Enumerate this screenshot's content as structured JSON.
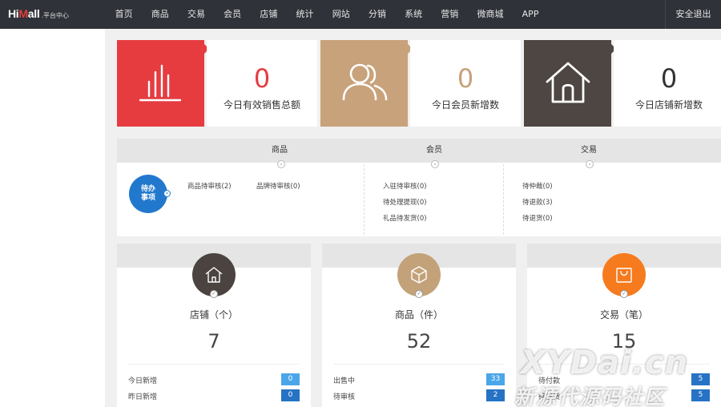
{
  "header": {
    "logo_mark_a": "Hi",
    "logo_mark_b": "M",
    "logo_mark_c": "all",
    "logo_sub": ".平台中心",
    "nav": [
      "首页",
      "商品",
      "交易",
      "会员",
      "店铺",
      "统计",
      "网站",
      "分销",
      "系统",
      "营销",
      "微商城",
      "APP"
    ],
    "logout": "安全退出"
  },
  "stats": [
    {
      "value": "0",
      "label": "今日有效销售总额",
      "color": "#e63c40",
      "value_color": "#e63c40",
      "icon": "bar-chart-icon"
    },
    {
      "value": "0",
      "label": "今日会员新增数",
      "color": "#c7a27a",
      "value_color": "#c7a27a",
      "icon": "users-icon"
    },
    {
      "value": "0",
      "label": "今日店铺新增数",
      "color": "#4d4642",
      "value_color": "#333333",
      "icon": "home-icon"
    }
  ],
  "todo": {
    "badge_line1": "待办",
    "badge_line2": "事项",
    "columns": [
      {
        "title": "商品",
        "links": [
          "商品待审核(2)",
          "品牌待审核(0)"
        ]
      },
      {
        "title": "会员",
        "links": [
          "入驻待审核(0)",
          "待处理提现(0)",
          "礼品待发货(0)"
        ]
      },
      {
        "title": "交易",
        "links": [
          "待仲裁(0)",
          "待退款(3)",
          "待退货(0)"
        ]
      }
    ]
  },
  "summaries": [
    {
      "title": "店铺（个）",
      "total": "7",
      "color": "#4a4340",
      "icon": "store-icon",
      "badge_color": "#4aa6e8",
      "rows": [
        {
          "label": "今日新增",
          "value": "0",
          "color": "#4aa6e8"
        },
        {
          "label": "昨日新增",
          "value": "0",
          "color": "#2672c4"
        }
      ]
    },
    {
      "title": "商品（件）",
      "total": "52",
      "color": "#c3a27a",
      "icon": "box-icon",
      "rows": [
        {
          "label": "出售中",
          "value": "33",
          "color": "#4aa6e8"
        },
        {
          "label": "待审核",
          "value": "2",
          "color": "#2672c4"
        }
      ]
    },
    {
      "title": "交易（笔）",
      "total": "15",
      "color": "#f57b1e",
      "icon": "bag-icon",
      "rows": [
        {
          "label": "待付款",
          "value": "5",
          "color": "#4aa6e8"
        },
        {
          "label": "待发货",
          "value": "5",
          "color": "#2672c4"
        }
      ]
    }
  ],
  "watermark": {
    "line1": "XYDai.cn",
    "line2": "新源代源码社区"
  }
}
